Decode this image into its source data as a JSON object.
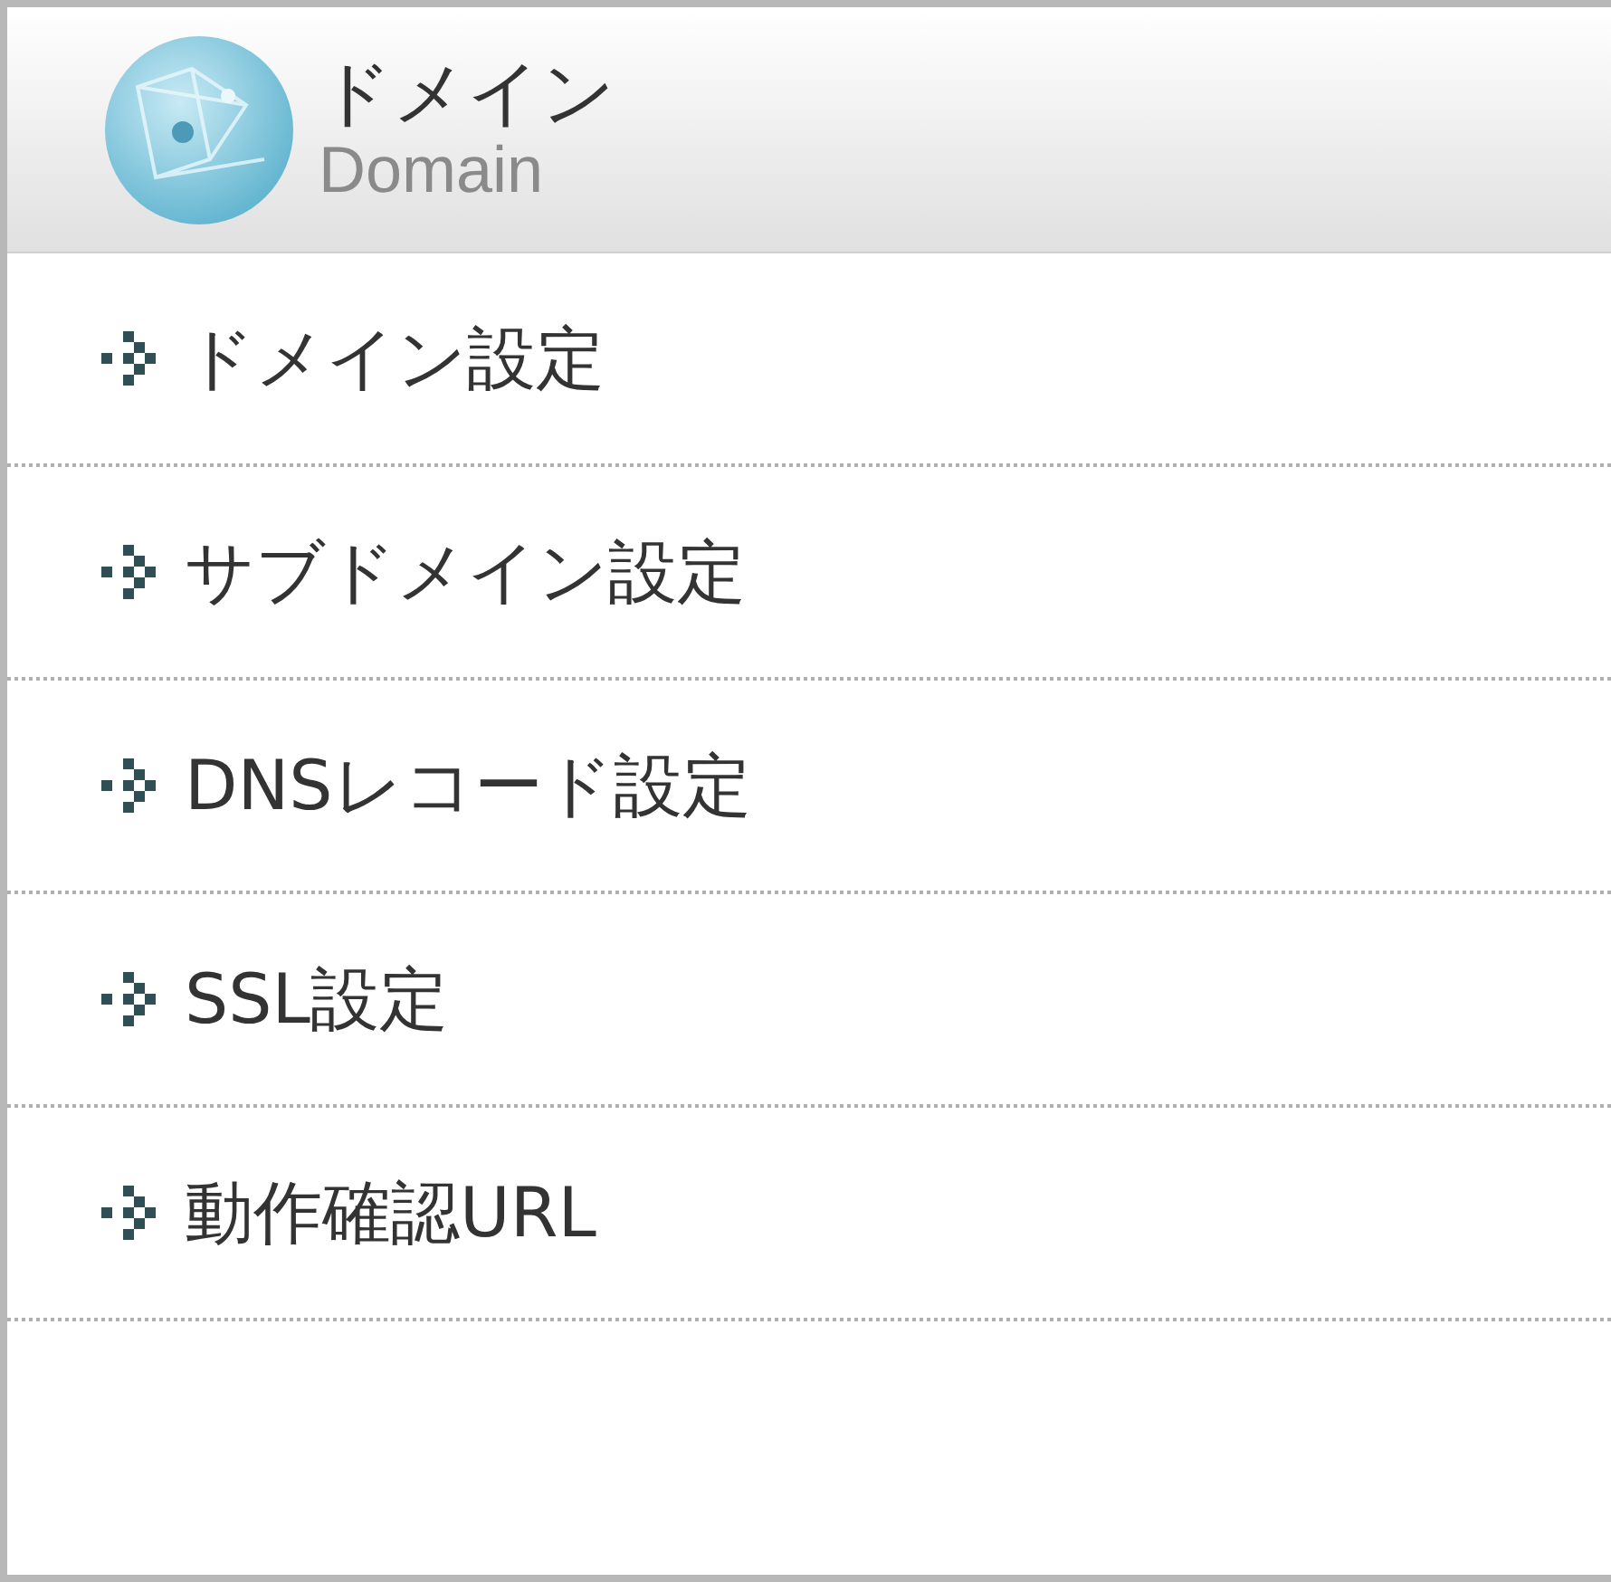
{
  "header": {
    "title": "ドメイン",
    "subtitle": "Domain"
  },
  "menu": [
    {
      "label": "ドメイン設定"
    },
    {
      "label": "サブドメイン設定"
    },
    {
      "label": "DNSレコード設定"
    },
    {
      "label": "SSL設定"
    },
    {
      "label": "動作確認URL"
    }
  ]
}
